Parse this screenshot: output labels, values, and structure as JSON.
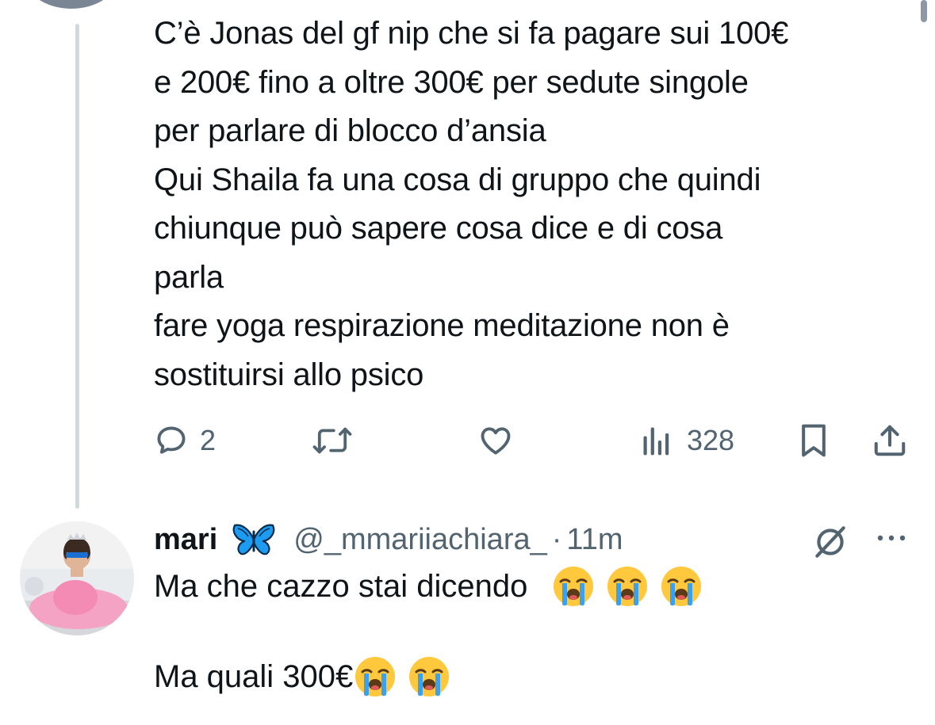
{
  "tweet": {
    "lines": [
      "C’è Jonas del gf nip che si fa pagare sui 100€",
      "e 200€ fino a oltre 300€ per sedute singole",
      "per parlare di blocco d’ansia",
      "Qui Shaila fa una cosa di gruppo che quindi",
      "chiunque può sapere cosa dice e di cosa",
      "parla",
      "fare yoga respirazione meditazione non è",
      "sostituirsi allo psico"
    ],
    "actions": {
      "reply_icon": "speech-bubble-icon",
      "reply_count": "2",
      "retweet_icon": "retweet-icon",
      "like_icon": "heart-icon",
      "views_icon": "bar-chart-icon",
      "views_count": "328",
      "bookmark_icon": "bookmark-icon",
      "share_icon": "share-icon"
    }
  },
  "reply": {
    "name": "mari",
    "name_emoji": "butterfly-emoji",
    "handle": "@_mmariiachiara_",
    "separator": "·",
    "time": "11m",
    "line1": "Ma che cazzo stai dicendo",
    "line2": "Ma quali 300€",
    "line1_emoji_count": 3,
    "line2_emoji_count": 2,
    "emoji": "loudly-crying-face-emoji"
  },
  "colors": {
    "text": "#0f1419",
    "secondary": "#536471",
    "thread_line": "#cfd9de",
    "butterfly": "#1d9bf0"
  }
}
